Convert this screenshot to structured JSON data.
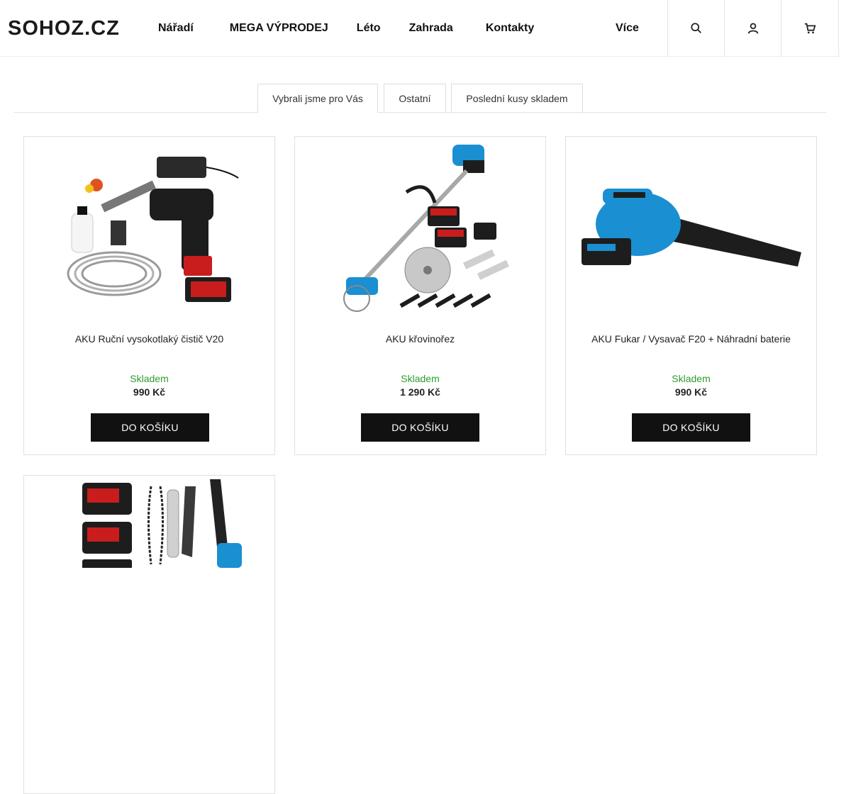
{
  "header": {
    "logo_text": "SOHOZ.CZ",
    "nav": [
      {
        "label": "Nářadí",
        "has_caret": true
      },
      {
        "label": "MEGA VÝPRODEJ",
        "lead_glyph": ""
      },
      {
        "label": "Léto"
      },
      {
        "label": "Zahrada",
        "has_caret": true
      },
      {
        "label": "Kontakty"
      }
    ],
    "more_label": "Více",
    "caret_glyph": "",
    "icons": [
      "search-icon",
      "user-icon",
      "cart-icon"
    ]
  },
  "tabs": [
    {
      "label": "Vybrali jsme pro Vás",
      "active": true
    },
    {
      "label": "Ostatní",
      "active": false
    },
    {
      "label": "Poslední kusy skladem",
      "active": false
    }
  ],
  "products": [
    {
      "name": "AKU Ruční vysokotlaký čistič V20",
      "stock": "Skladem",
      "price": "990 Kč",
      "button": "DO KOŠÍKU",
      "image": "pressure-washer-image"
    },
    {
      "name": "AKU křovinořez",
      "stock": "Skladem",
      "price": "1 290 Kč",
      "button": "DO KOŠÍKU",
      "image": "brush-cutter-image"
    },
    {
      "name": "AKU Fukar / Vysavač F20 + Náhradní baterie",
      "stock": "Skladem",
      "price": "990 Kč",
      "button": "DO KOŠÍKU",
      "image": "blower-image"
    },
    {
      "image": "chainsaw-image"
    }
  ],
  "colors": {
    "accent_tool": "#1a8fd1",
    "battery_red": "#d62020",
    "stock_green": "#2d9c2d",
    "button_bg": "#111111"
  }
}
